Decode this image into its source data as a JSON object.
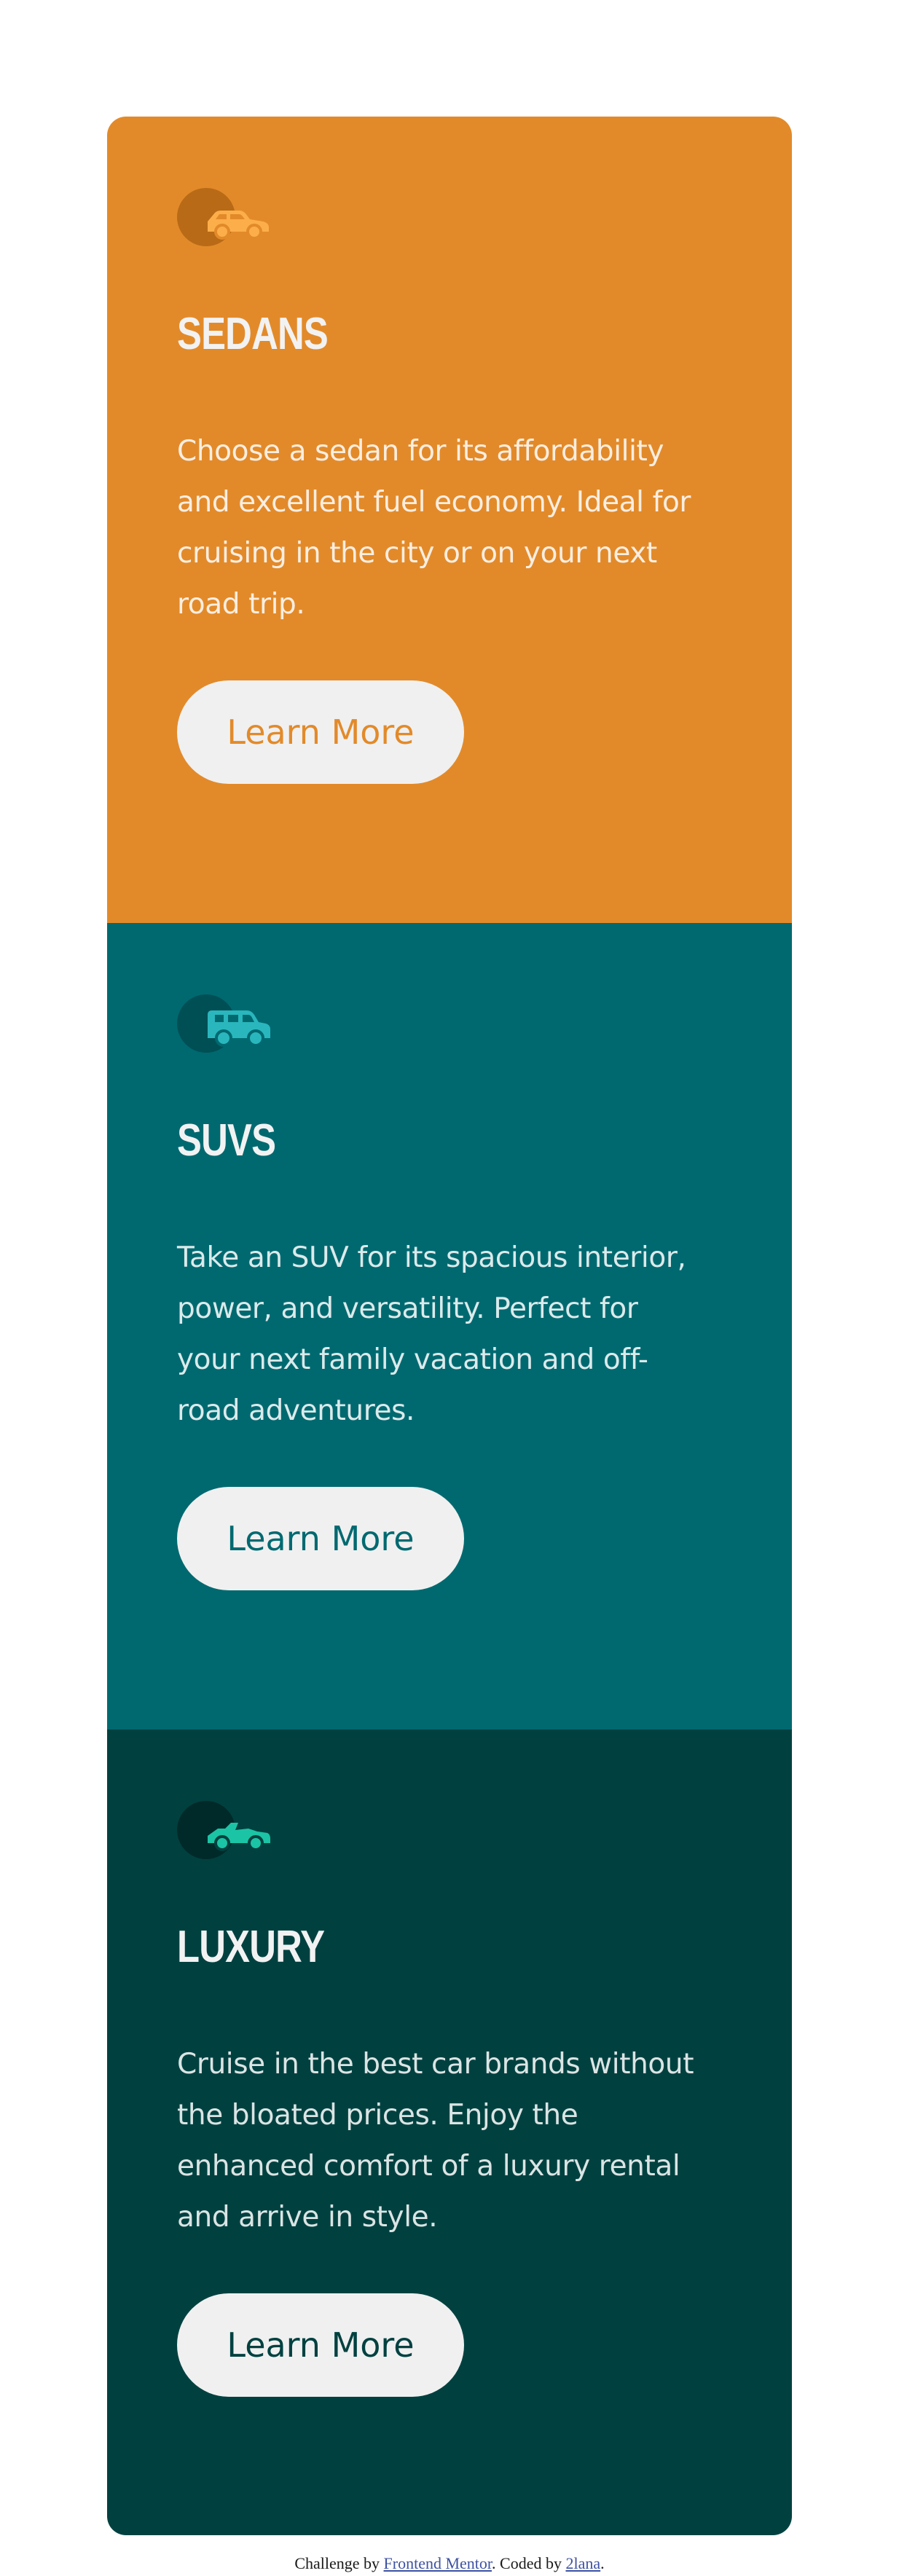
{
  "cards": [
    {
      "icon": "sedan-icon",
      "title": "Sedans",
      "description": "Choose a sedan for its affordability and excellent fuel economy. Ideal for cruising in the city or on your next road trip.",
      "button_label": "Learn More",
      "bg_color": "#e28a2a"
    },
    {
      "icon": "suv-icon",
      "title": "SUVs",
      "description": "Take an SUV for its spacious interior, power, and versatility. Perfect for your next family vacation and off-road adventures.",
      "button_label": "Learn More",
      "bg_color": "#006970"
    },
    {
      "icon": "luxury-car-icon",
      "title": "Luxury",
      "description": "Cruise in the best car brands without the bloated prices. Enjoy the enhanced comfort of a luxury rental and arrive in style.",
      "button_label": "Learn More",
      "bg_color": "#004140"
    }
  ],
  "attribution": {
    "prefix": "Challenge by ",
    "link1": "Frontend Mentor",
    "middle": ". Coded by ",
    "link2": "2lana",
    "suffix": "."
  },
  "colors": {
    "button_bg": "#f0f0f0",
    "text_light": "#f2f2f2"
  }
}
